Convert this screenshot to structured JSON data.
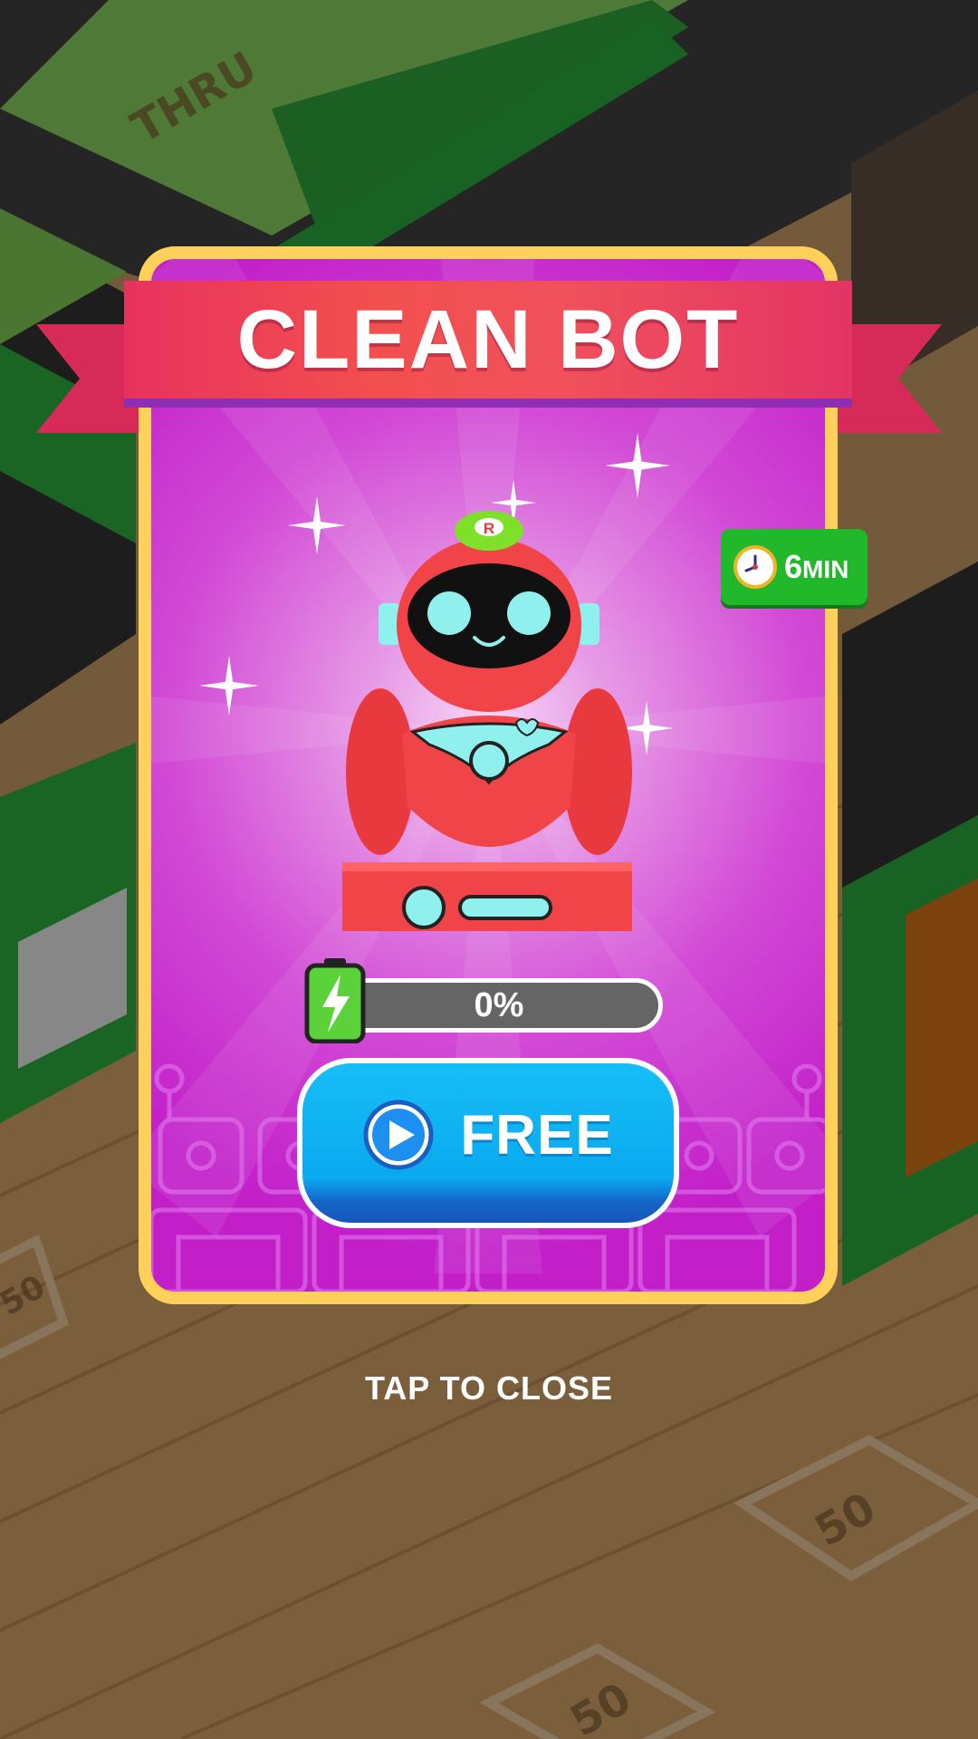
{
  "background": {
    "drive_thru_sign": "THRU",
    "price_tiles": [
      "50",
      "50",
      "50"
    ]
  },
  "popup": {
    "title": "CLEAN BOT",
    "timer": {
      "value": "6",
      "unit": "MIN",
      "icon": "clock-icon"
    },
    "robot_badge_letter": "R",
    "progress": {
      "label": "0%",
      "fraction": 0,
      "icon": "battery-bolt-icon"
    },
    "free_button": {
      "label": "FREE",
      "icon": "play-icon"
    }
  },
  "close_label": "TAP TO CLOSE",
  "colors": {
    "card_border": "#ffd05a",
    "card_bg": "#c21fc9",
    "ribbon": "#ef4a5c",
    "timer_bg": "#21b82c",
    "button": "#0aa9f0",
    "robot": "#f0484a",
    "robot_accent": "#8ff0ee"
  }
}
